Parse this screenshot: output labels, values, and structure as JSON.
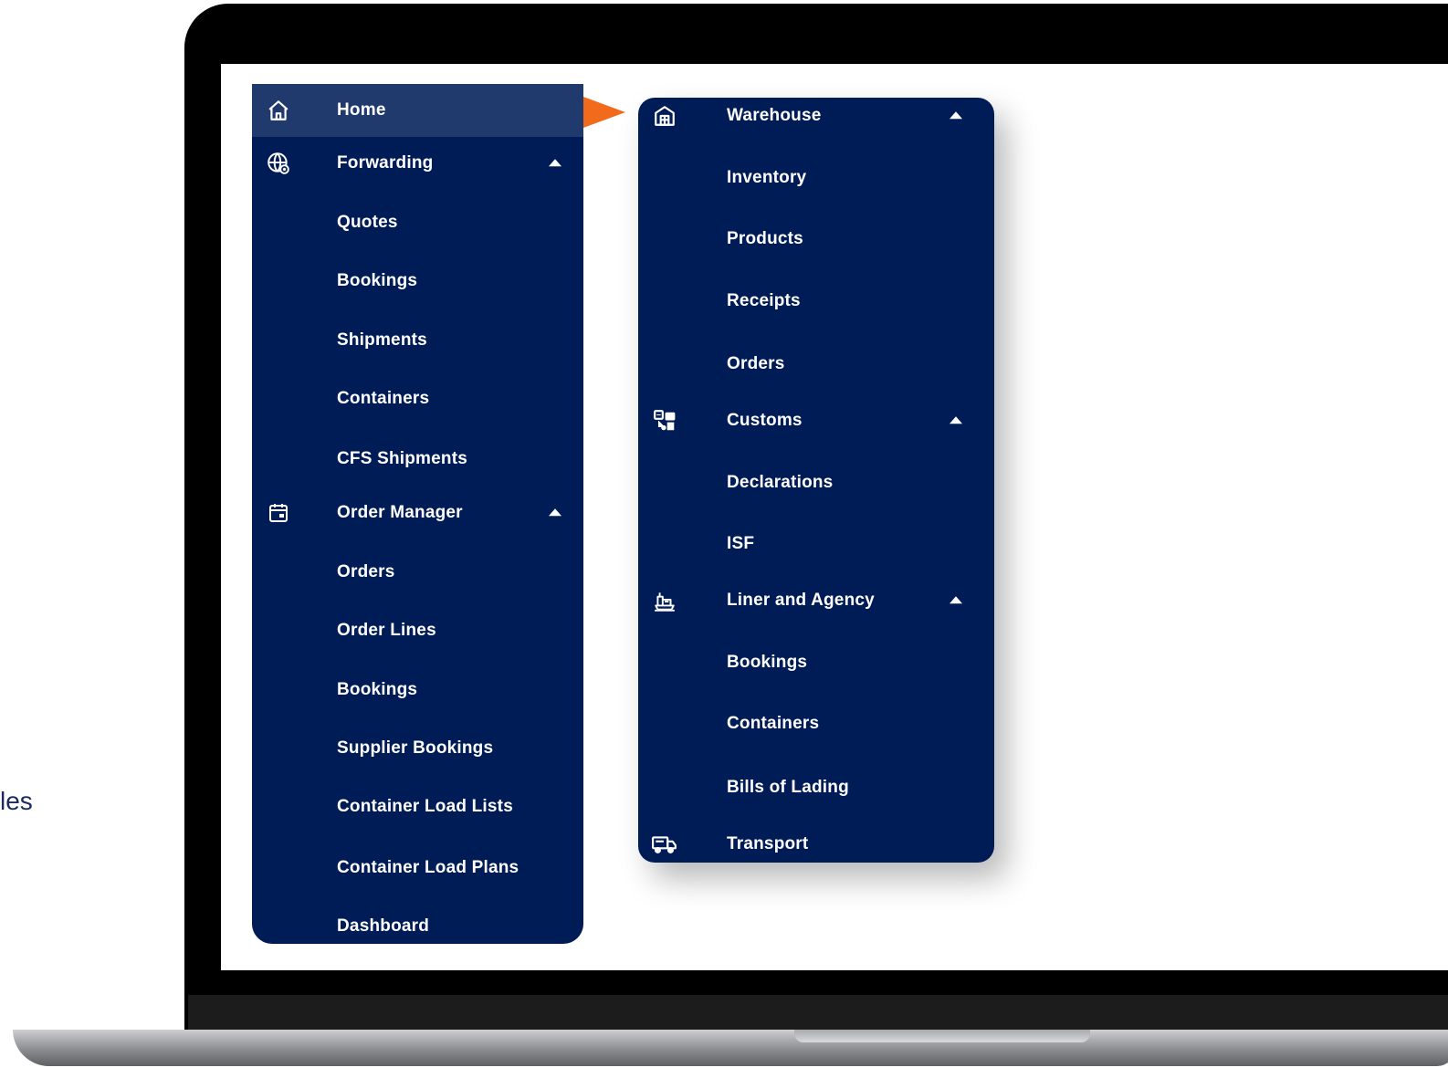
{
  "page": {
    "stray_text": "les"
  },
  "left_menu": {
    "items": [
      {
        "label": "Home",
        "icon": "home-icon",
        "active": true
      },
      {
        "label": "Forwarding",
        "icon": "globe-icon",
        "expanded": true
      },
      {
        "label": "Quotes"
      },
      {
        "label": "Bookings"
      },
      {
        "label": "Shipments"
      },
      {
        "label": "Containers"
      },
      {
        "label": "CFS Shipments"
      },
      {
        "label": "Order Manager",
        "icon": "calendar-box-icon",
        "expanded": true
      },
      {
        "label": "Orders"
      },
      {
        "label": "Order Lines"
      },
      {
        "label": "Bookings"
      },
      {
        "label": "Supplier Bookings"
      },
      {
        "label": "Container Load Lists"
      },
      {
        "label": "Container Load Plans"
      },
      {
        "label": "Dashboard"
      }
    ]
  },
  "right_menu": {
    "items": [
      {
        "label": "Warehouse",
        "icon": "warehouse-icon",
        "expanded": true
      },
      {
        "label": "Inventory"
      },
      {
        "label": "Products"
      },
      {
        "label": "Receipts"
      },
      {
        "label": "Orders"
      },
      {
        "label": "Customs",
        "icon": "customs-icon",
        "expanded": true
      },
      {
        "label": "Declarations"
      },
      {
        "label": "ISF"
      },
      {
        "label": "Liner and Agency",
        "icon": "ship-icon",
        "expanded": true
      },
      {
        "label": "Bookings"
      },
      {
        "label": "Containers"
      },
      {
        "label": "Bills of Lading"
      },
      {
        "label": "Transport",
        "icon": "truck-icon"
      }
    ]
  },
  "colors": {
    "menu_bg": "#001c57",
    "active_bg": "#213a6e",
    "accent_arrow": "#f26b1d"
  }
}
